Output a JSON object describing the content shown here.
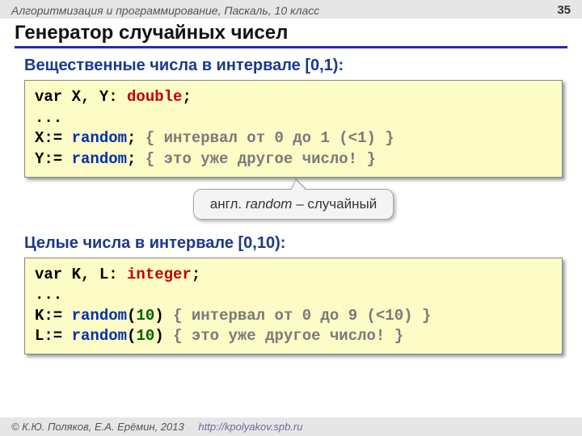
{
  "header": {
    "course": "Алгоритмизация и программирование, Паскаль, 10 класс",
    "page": "35"
  },
  "title": "Генератор случайных чисел",
  "section1": {
    "heading": "Вещественные числа в интервале [0,1):",
    "code": {
      "l1a": "var X, Y: ",
      "l1b": "double",
      "l1c": ";",
      "l2": "...",
      "l3a": "X:= ",
      "l3b": "random",
      "l3c": "; ",
      "l3d": "{ интервал от 0 до 1 (<1) }",
      "l4a": "Y:= ",
      "l4b": "random",
      "l4c": "; ",
      "l4d": "{ это уже другое число! }"
    }
  },
  "callout": {
    "pre": "англ. ",
    "word": "random",
    "post": " – случайный"
  },
  "section2": {
    "heading": "Целые числа в интервале [0,10):",
    "code": {
      "l1a": "var K, L: ",
      "l1b": "integer",
      "l1c": ";",
      "l2": "...",
      "l3a": "K:= ",
      "l3b": "random",
      "l3c": "(",
      "l3d": "10",
      "l3e": ") ",
      "l3f": "{ интервал от 0 до 9 (<10) }",
      "l4a": "L:= ",
      "l4b": "random",
      "l4c": "(",
      "l4d": "10",
      "l4e": ") ",
      "l4f": "{ это уже другое число! }"
    }
  },
  "footer": {
    "copy": "© К.Ю. Поляков, Е.А. Ерёмин, 2013",
    "url": "http://kpolyakov.spb.ru"
  }
}
